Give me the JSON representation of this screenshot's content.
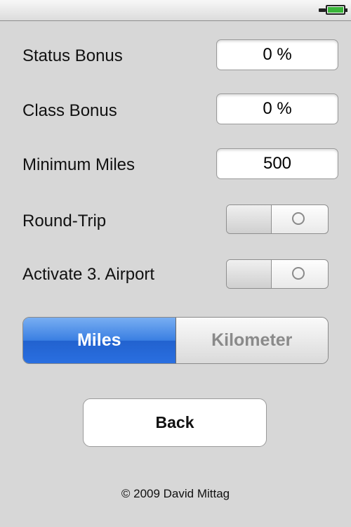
{
  "status_bar": {
    "battery_icon": "battery-charging-icon",
    "battery_color": "#3ab53a"
  },
  "settings": {
    "status_bonus": {
      "label": "Status Bonus",
      "value": "0 %"
    },
    "class_bonus": {
      "label": "Class Bonus",
      "value": "0 %"
    },
    "minimum_miles": {
      "label": "Minimum Miles",
      "value": "500"
    },
    "round_trip": {
      "label": "Round-Trip",
      "state": "off"
    },
    "third_airport": {
      "label": "Activate 3. Airport",
      "state": "off"
    }
  },
  "units": {
    "options": [
      "Miles",
      "Kilometer"
    ],
    "selected": "Miles",
    "accent_color": "#2a6fe0"
  },
  "back_button": {
    "label": "Back"
  },
  "footer": {
    "copyright": "© 2009 David Mittag"
  }
}
